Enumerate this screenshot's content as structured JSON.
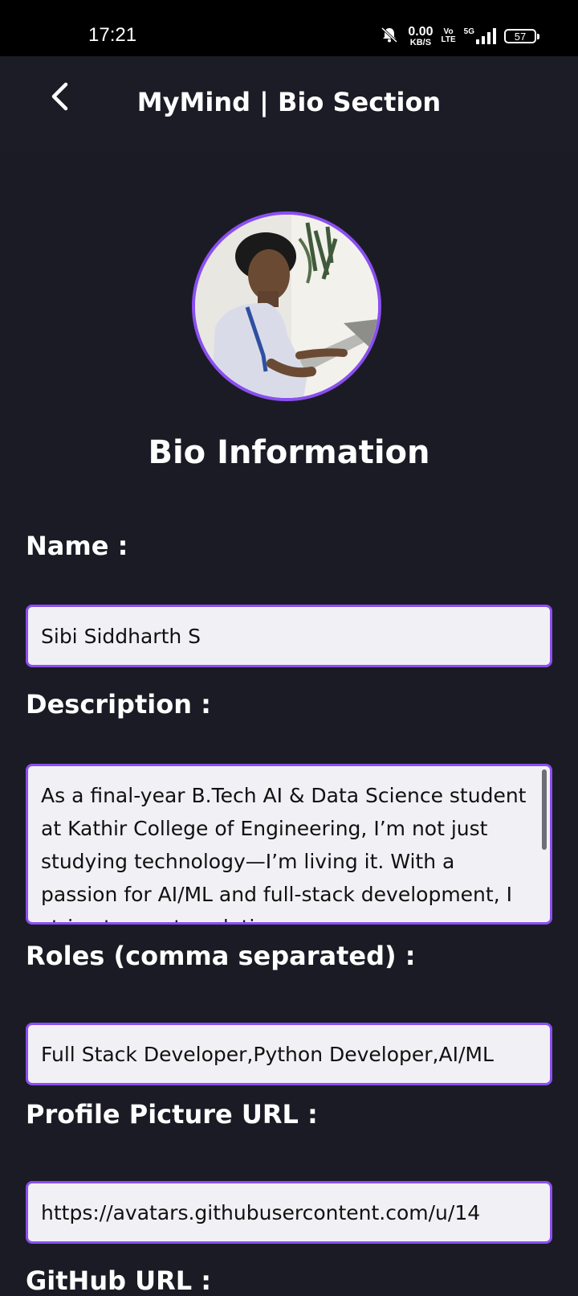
{
  "status_bar": {
    "time": "17:21",
    "net_speed": "0.00",
    "net_unit": "KB/S",
    "volte_top": "Vo",
    "volte_bottom": "LTE",
    "network": "5G",
    "battery": "57"
  },
  "app_bar": {
    "title": "MyMind | Bio Section"
  },
  "section_heading": "Bio Information",
  "form": {
    "name_label": "Name :",
    "name_value": "Sibi Siddharth S",
    "description_label": "Description :",
    "description_value": "As a final-year B.Tech AI & Data Science student at Kathir College of Engineering, I’m not just studying technology—I’m living it. With a passion for AI/ML and full-stack development, I strive to create solutions",
    "roles_label": "Roles (comma separated) :",
    "roles_value": "Full Stack Developer,Python Developer,AI/ML",
    "picture_label": "Profile Picture URL :",
    "picture_value": "https://avatars.githubusercontent.com/u/14",
    "github_label": "GitHub URL :"
  },
  "colors": {
    "accent": "#8a4ff0",
    "background": "#1b1b25",
    "input_bg": "#f1f1f5"
  }
}
